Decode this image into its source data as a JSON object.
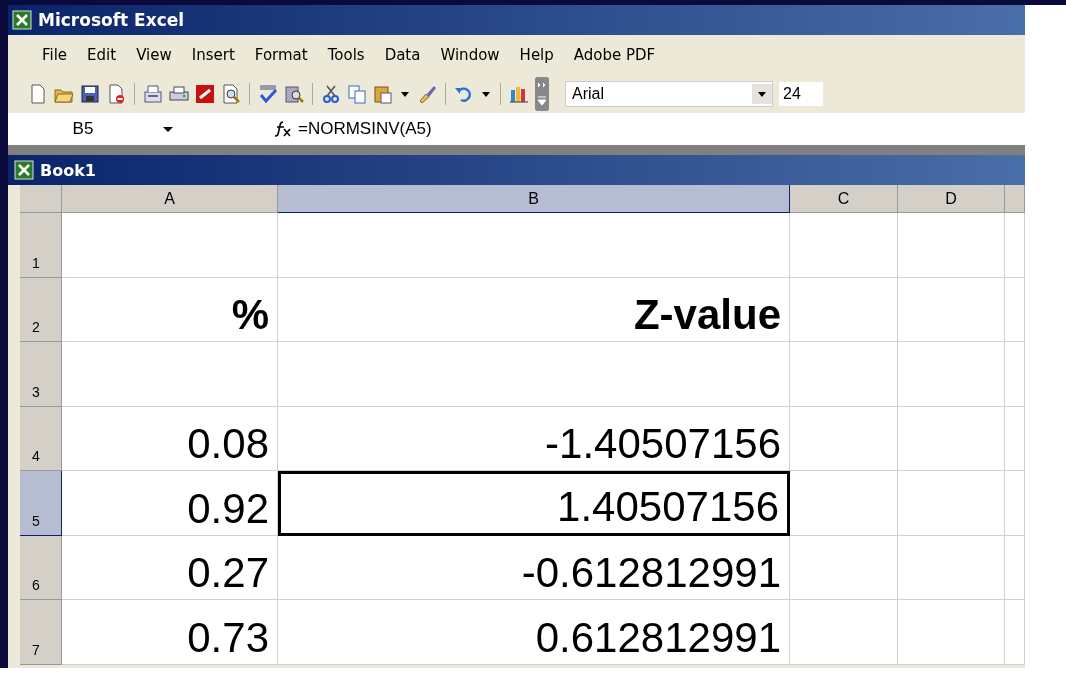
{
  "window": {
    "title": "Microsoft Excel"
  },
  "menu": [
    "File",
    "Edit",
    "View",
    "Insert",
    "Format",
    "Tools",
    "Data",
    "Window",
    "Help",
    "Adobe PDF"
  ],
  "toolbar": {
    "font": "Arial",
    "font_size": "24"
  },
  "formula_bar": {
    "name_box": "B5",
    "formula": "=NORMSINV(A5)"
  },
  "workbook": {
    "title": "Book1"
  },
  "columns": [
    {
      "label": "A",
      "selected": false
    },
    {
      "label": "B",
      "selected": true
    },
    {
      "label": "C",
      "selected": false
    },
    {
      "label": "D",
      "selected": false
    }
  ],
  "rows": [
    {
      "label": "1",
      "selected": false,
      "cells": []
    },
    {
      "label": "2",
      "selected": false,
      "cells": [
        {
          "text": "%",
          "bold": true,
          "selected": false
        },
        {
          "text": "Z-value",
          "bold": true,
          "selected": false
        }
      ]
    },
    {
      "label": "3",
      "selected": false,
      "cells": []
    },
    {
      "label": "4",
      "selected": false,
      "cells": [
        {
          "text": "0.08",
          "bold": false,
          "selected": false
        },
        {
          "text": "-1.40507156",
          "bold": false,
          "selected": false
        }
      ]
    },
    {
      "label": "5",
      "selected": true,
      "cells": [
        {
          "text": "0.92",
          "bold": false,
          "selected": false
        },
        {
          "text": "1.40507156",
          "bold": false,
          "selected": true
        }
      ]
    },
    {
      "label": "6",
      "selected": false,
      "cells": [
        {
          "text": "0.27",
          "bold": false,
          "selected": false
        },
        {
          "text": "-0.612812991",
          "bold": false,
          "selected": false
        }
      ]
    },
    {
      "label": "7",
      "selected": false,
      "cells": [
        {
          "text": "0.73",
          "bold": false,
          "selected": false
        },
        {
          "text": "0.612812991",
          "bold": false,
          "selected": false
        }
      ]
    }
  ]
}
